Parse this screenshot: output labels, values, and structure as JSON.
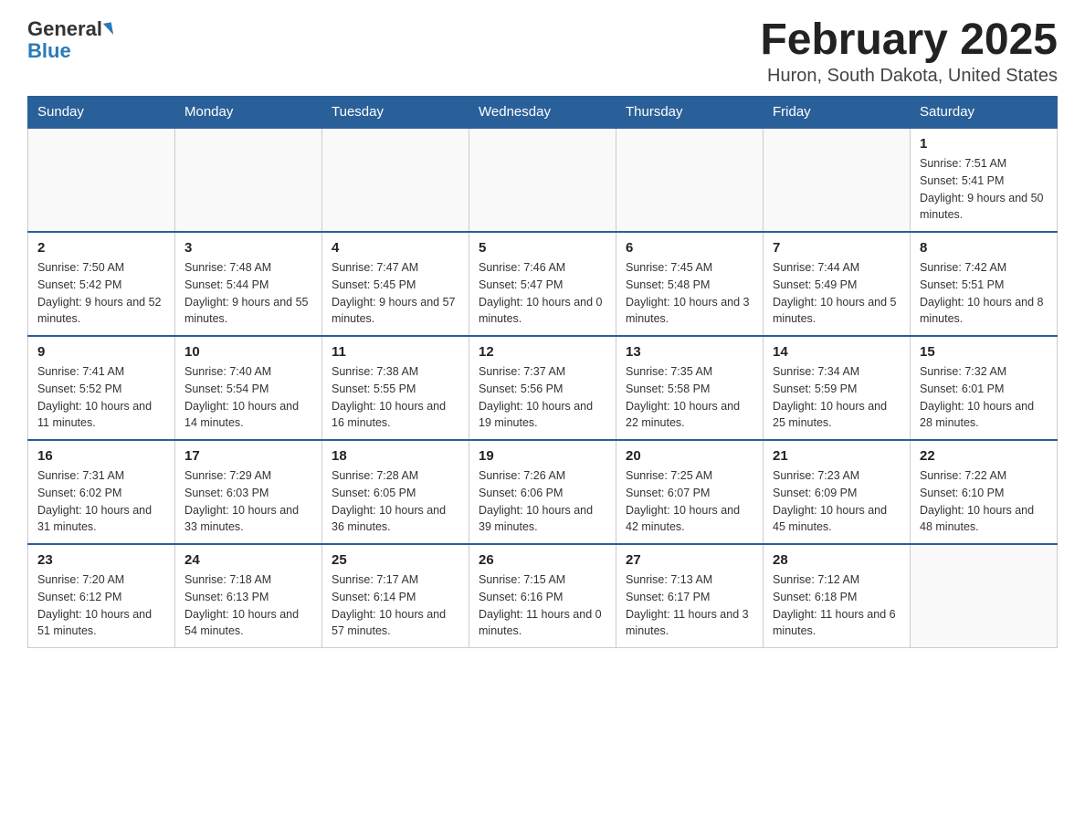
{
  "logo": {
    "general": "General",
    "blue": "Blue",
    "arrow": "▶"
  },
  "title": "February 2025",
  "location": "Huron, South Dakota, United States",
  "days_of_week": [
    "Sunday",
    "Monday",
    "Tuesday",
    "Wednesday",
    "Thursday",
    "Friday",
    "Saturday"
  ],
  "weeks": [
    [
      {
        "day": "",
        "info": ""
      },
      {
        "day": "",
        "info": ""
      },
      {
        "day": "",
        "info": ""
      },
      {
        "day": "",
        "info": ""
      },
      {
        "day": "",
        "info": ""
      },
      {
        "day": "",
        "info": ""
      },
      {
        "day": "1",
        "info": "Sunrise: 7:51 AM\nSunset: 5:41 PM\nDaylight: 9 hours and 50 minutes."
      }
    ],
    [
      {
        "day": "2",
        "info": "Sunrise: 7:50 AM\nSunset: 5:42 PM\nDaylight: 9 hours and 52 minutes."
      },
      {
        "day": "3",
        "info": "Sunrise: 7:48 AM\nSunset: 5:44 PM\nDaylight: 9 hours and 55 minutes."
      },
      {
        "day": "4",
        "info": "Sunrise: 7:47 AM\nSunset: 5:45 PM\nDaylight: 9 hours and 57 minutes."
      },
      {
        "day": "5",
        "info": "Sunrise: 7:46 AM\nSunset: 5:47 PM\nDaylight: 10 hours and 0 minutes."
      },
      {
        "day": "6",
        "info": "Sunrise: 7:45 AM\nSunset: 5:48 PM\nDaylight: 10 hours and 3 minutes."
      },
      {
        "day": "7",
        "info": "Sunrise: 7:44 AM\nSunset: 5:49 PM\nDaylight: 10 hours and 5 minutes."
      },
      {
        "day": "8",
        "info": "Sunrise: 7:42 AM\nSunset: 5:51 PM\nDaylight: 10 hours and 8 minutes."
      }
    ],
    [
      {
        "day": "9",
        "info": "Sunrise: 7:41 AM\nSunset: 5:52 PM\nDaylight: 10 hours and 11 minutes."
      },
      {
        "day": "10",
        "info": "Sunrise: 7:40 AM\nSunset: 5:54 PM\nDaylight: 10 hours and 14 minutes."
      },
      {
        "day": "11",
        "info": "Sunrise: 7:38 AM\nSunset: 5:55 PM\nDaylight: 10 hours and 16 minutes."
      },
      {
        "day": "12",
        "info": "Sunrise: 7:37 AM\nSunset: 5:56 PM\nDaylight: 10 hours and 19 minutes."
      },
      {
        "day": "13",
        "info": "Sunrise: 7:35 AM\nSunset: 5:58 PM\nDaylight: 10 hours and 22 minutes."
      },
      {
        "day": "14",
        "info": "Sunrise: 7:34 AM\nSunset: 5:59 PM\nDaylight: 10 hours and 25 minutes."
      },
      {
        "day": "15",
        "info": "Sunrise: 7:32 AM\nSunset: 6:01 PM\nDaylight: 10 hours and 28 minutes."
      }
    ],
    [
      {
        "day": "16",
        "info": "Sunrise: 7:31 AM\nSunset: 6:02 PM\nDaylight: 10 hours and 31 minutes."
      },
      {
        "day": "17",
        "info": "Sunrise: 7:29 AM\nSunset: 6:03 PM\nDaylight: 10 hours and 33 minutes."
      },
      {
        "day": "18",
        "info": "Sunrise: 7:28 AM\nSunset: 6:05 PM\nDaylight: 10 hours and 36 minutes."
      },
      {
        "day": "19",
        "info": "Sunrise: 7:26 AM\nSunset: 6:06 PM\nDaylight: 10 hours and 39 minutes."
      },
      {
        "day": "20",
        "info": "Sunrise: 7:25 AM\nSunset: 6:07 PM\nDaylight: 10 hours and 42 minutes."
      },
      {
        "day": "21",
        "info": "Sunrise: 7:23 AM\nSunset: 6:09 PM\nDaylight: 10 hours and 45 minutes."
      },
      {
        "day": "22",
        "info": "Sunrise: 7:22 AM\nSunset: 6:10 PM\nDaylight: 10 hours and 48 minutes."
      }
    ],
    [
      {
        "day": "23",
        "info": "Sunrise: 7:20 AM\nSunset: 6:12 PM\nDaylight: 10 hours and 51 minutes."
      },
      {
        "day": "24",
        "info": "Sunrise: 7:18 AM\nSunset: 6:13 PM\nDaylight: 10 hours and 54 minutes."
      },
      {
        "day": "25",
        "info": "Sunrise: 7:17 AM\nSunset: 6:14 PM\nDaylight: 10 hours and 57 minutes."
      },
      {
        "day": "26",
        "info": "Sunrise: 7:15 AM\nSunset: 6:16 PM\nDaylight: 11 hours and 0 minutes."
      },
      {
        "day": "27",
        "info": "Sunrise: 7:13 AM\nSunset: 6:17 PM\nDaylight: 11 hours and 3 minutes."
      },
      {
        "day": "28",
        "info": "Sunrise: 7:12 AM\nSunset: 6:18 PM\nDaylight: 11 hours and 6 minutes."
      },
      {
        "day": "",
        "info": ""
      }
    ]
  ]
}
